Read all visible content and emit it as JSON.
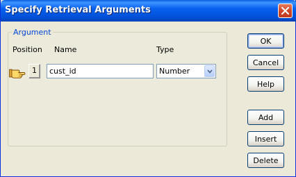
{
  "window": {
    "title": "Specify Retrieval Arguments"
  },
  "group": {
    "legend": "Argument",
    "headers": {
      "position": "Position",
      "name": "Name",
      "type": "Type"
    }
  },
  "rows": [
    {
      "position": "1",
      "name": "cust_id",
      "type": "Number"
    }
  ],
  "buttons": {
    "ok": "OK",
    "cancel": "Cancel",
    "help": "Help",
    "add": "Add",
    "insert": "Insert",
    "delete": "Delete"
  },
  "icons": {
    "row_pointer": "pointing-hand-icon",
    "close": "close-icon",
    "dropdown": "chevron-down-icon"
  },
  "colors": {
    "titlebar": "#0054e3",
    "group_legend": "#0046d5",
    "close_button": "#d0472a"
  }
}
